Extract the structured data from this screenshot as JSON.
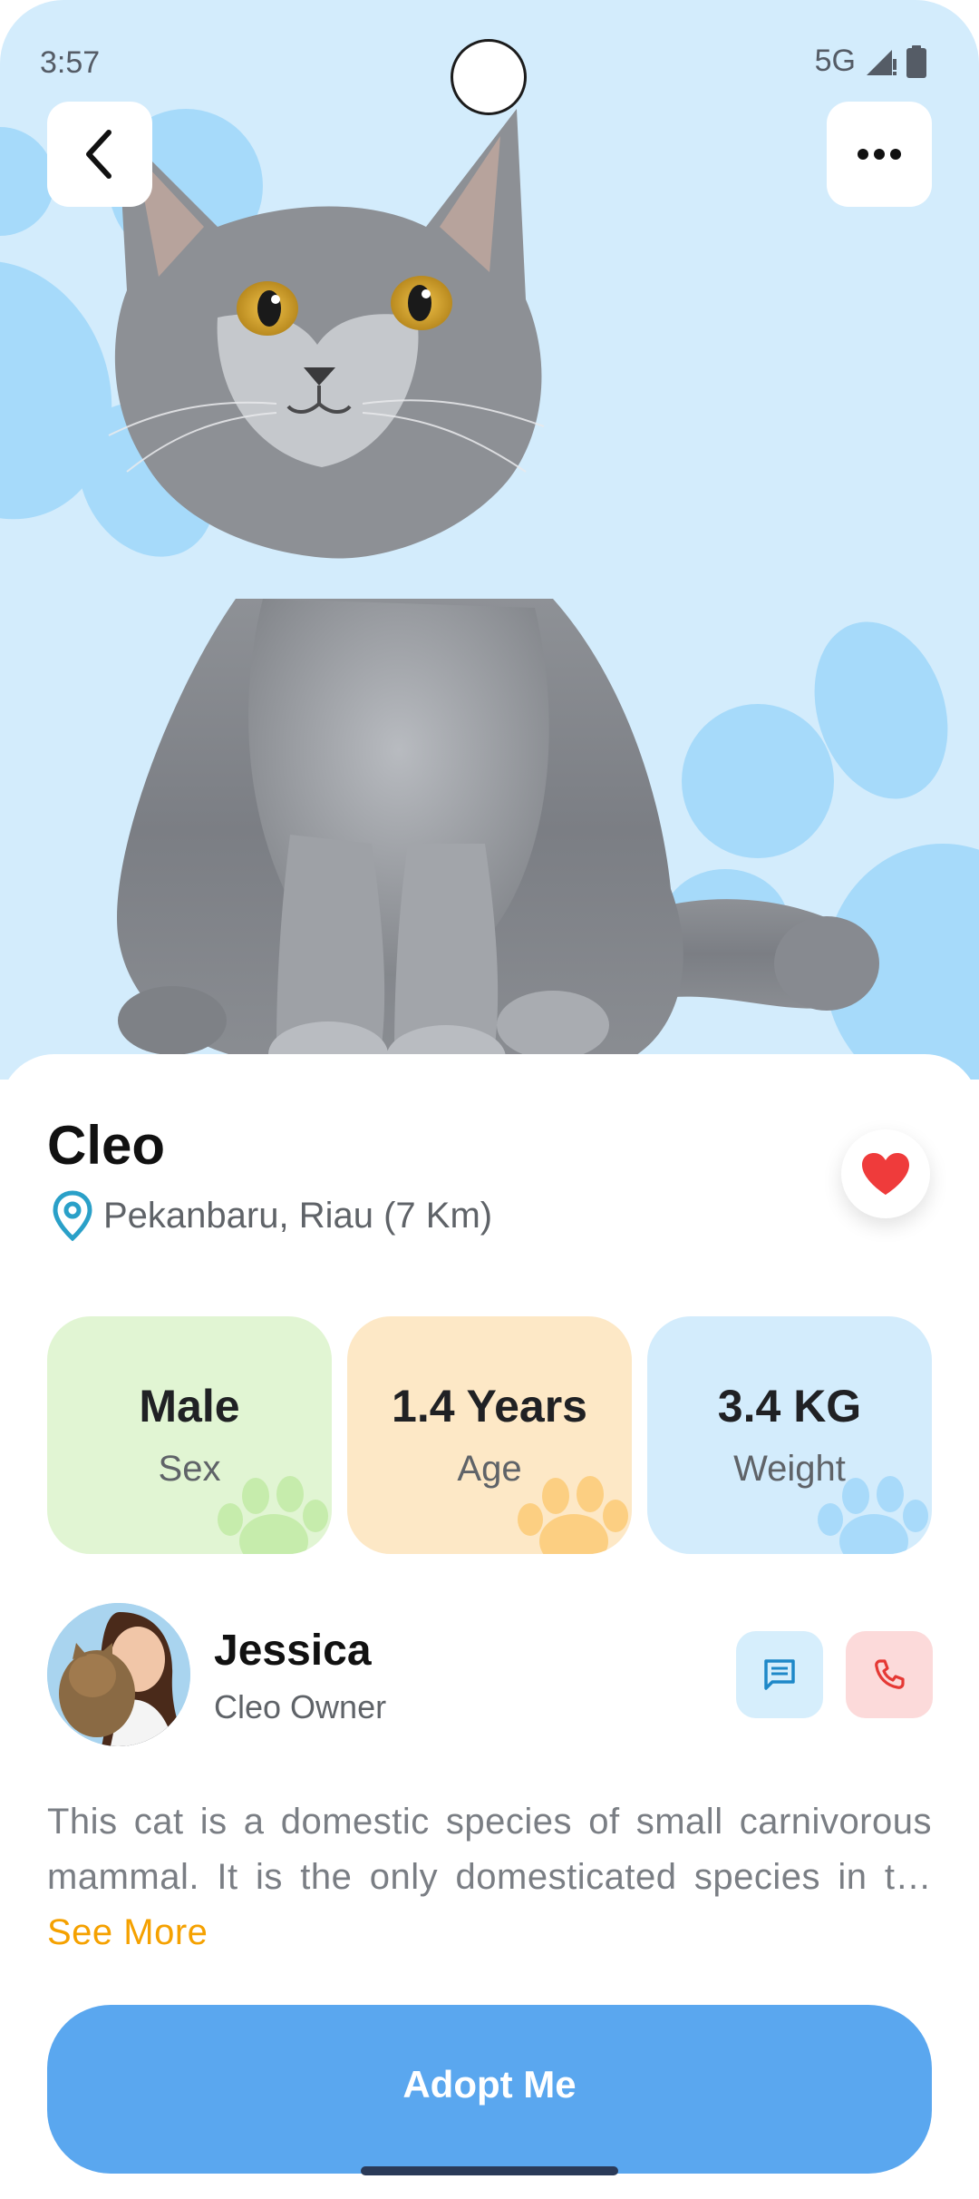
{
  "status_bar": {
    "time": "3:57",
    "network": "5G"
  },
  "header": {
    "back_icon": "chevron-left-icon",
    "more_icon": "more-horizontal-icon"
  },
  "pet": {
    "name": "Cleo",
    "location": "Pekanbaru, Riau (7 Km)",
    "favorite": true
  },
  "stats": [
    {
      "value": "Male",
      "label": "Sex",
      "color": "#e1f5d3",
      "paw_color": "#c6ecac"
    },
    {
      "value": "1.4 Years",
      "label": "Age",
      "color": "#fde8c6",
      "paw_color": "#fccf82"
    },
    {
      "value": "3.4 KG",
      "label": "Weight",
      "color": "#d3ecfc",
      "paw_color": "#a8dafa"
    }
  ],
  "owner": {
    "name": "Jessica",
    "role": "Cleo Owner"
  },
  "description": {
    "text": "This cat is a domestic species of small carnivorous mammal. It is the only domesticated species in t…",
    "see_more": "See More"
  },
  "cta": {
    "label": "Adopt Me"
  },
  "colors": {
    "hero_bg": "#d3ecfc",
    "paw": "#a6dafa",
    "accent": "#5aa7ef",
    "heart": "#ef3b3b",
    "see_more": "#f5a100"
  }
}
